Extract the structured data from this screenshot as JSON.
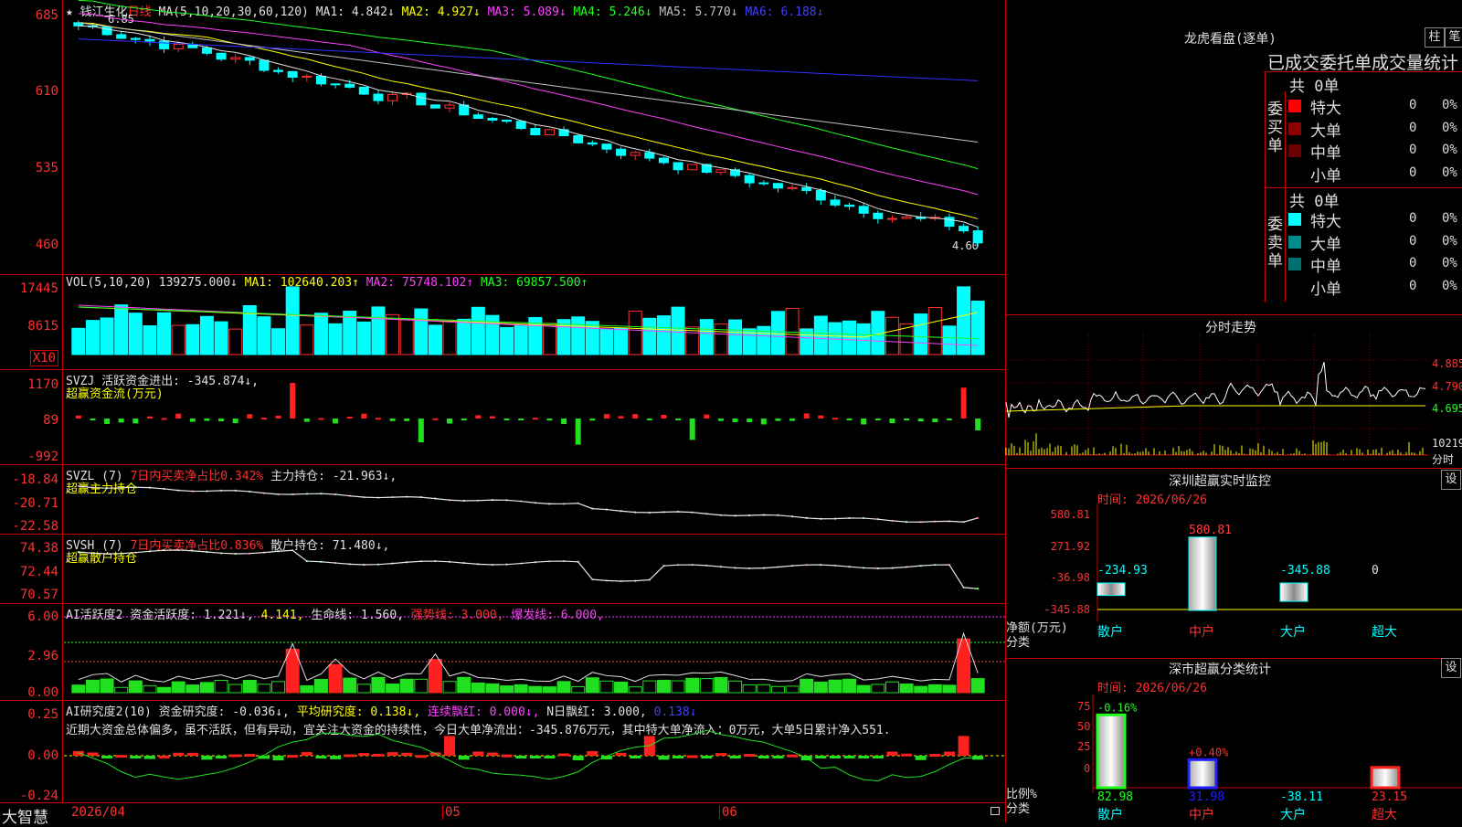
{
  "stock": {
    "name": "钱江生化",
    "period": "日线"
  },
  "ma_header": {
    "prefix": "MA(5,10,20,30,60,120)",
    "ma1": "MA1: 4.842↓",
    "ma2": "MA2: 4.927↓",
    "ma3": "MA3: 5.089↓",
    "ma4": "MA4: 5.246↓",
    "ma5": "MA5: 5.770↓",
    "ma6": "MA6: 6.188↓"
  },
  "price_axis": [
    "685",
    "610",
    "535",
    "460"
  ],
  "price_annot": {
    "high": "6.85",
    "low": "4.60"
  },
  "vol_header": {
    "prefix": "VOL(5,10,20)",
    "value": "139275.000↓",
    "ma1": "MA1: 102640.203↑",
    "ma2": "MA2: 75748.102↑",
    "ma3": "MA3: 69857.500↑"
  },
  "vol_axis": [
    "17445",
    "8615"
  ],
  "vol_unit": "X10",
  "svzj": {
    "line1": "SVZJ  活跃资金进出: -345.874↓,",
    "line2": "超赢资金流(万元)",
    "axis": [
      "1170",
      "89",
      "-992"
    ]
  },
  "svzl": {
    "prefix": "SVZL (7)",
    "pct": "7日内买卖净占比0.342%",
    "hold": "主力持仓: -21.963↓,",
    "line2": "超赢主力持仓",
    "axis": [
      "-18.84",
      "-20.71",
      "-22.58"
    ]
  },
  "svsh": {
    "prefix": "SVSH (7)",
    "pct": "7日内买卖净占比0.836%",
    "hold": "散户持仓: 71.480↓,",
    "line2": "超赢散户持仓",
    "axis": [
      "74.38",
      "72.44",
      "70.57"
    ]
  },
  "ai1": {
    "prefix": "AI活跃度2 资金活跃度: 1.221↓,",
    "v2": "4.141,",
    "life": "生命线: 1.560,",
    "strong": "强势线: 3.000,",
    "burst": "爆发线: 6.000,",
    "axis": [
      "6.00",
      "2.96",
      "0.00"
    ]
  },
  "ai2": {
    "prefix": "AI研究度2(10) 资金研究度: -0.036↓,",
    "avg": "平均研究度: 0.138↓,",
    "red": "连续飘红: 0.000↓,",
    "nday": "N日飘红: 3.000,",
    "last": "0.138↓",
    "axis": [
      "0.25",
      "0.00",
      "-0.24"
    ],
    "comment": "近期大资金总体偏多，虽不活跃，但有异动，宜关注大资金的持续性，今日大单净流出：-345.876万元，其中特大单净流入：0万元，大单5日累计净入551."
  },
  "date_axis": {
    "start": "2026/04",
    "m5": "05",
    "m6": "06"
  },
  "brand": "大智慧",
  "lhb": {
    "title": "龙虎看盘(逐单)",
    "btn1": "柱",
    "btn2": "笔",
    "subtitle": "已成交委托单成交量统计",
    "buy": {
      "label": "委买单",
      "total": "共 0单",
      "rows": [
        {
          "n": "特大",
          "v": "0",
          "p": "0%",
          "c": "#ff0000"
        },
        {
          "n": "大单",
          "v": "0",
          "p": "0%",
          "c": "#8b0000"
        },
        {
          "n": "中单",
          "v": "0",
          "p": "0%",
          "c": "#6b0000"
        },
        {
          "n": "小单",
          "v": "0",
          "p": "0%",
          "c": "#000000"
        }
      ]
    },
    "sell": {
      "label": "委卖单",
      "total": "共 0单",
      "rows": [
        {
          "n": "特大",
          "v": "0",
          "p": "0%",
          "c": "#00ffff"
        },
        {
          "n": "大单",
          "v": "0",
          "p": "0%",
          "c": "#008b8b"
        },
        {
          "n": "中单",
          "v": "0",
          "p": "0%",
          "c": "#007070"
        },
        {
          "n": "小单",
          "v": "0",
          "p": "0%",
          "c": "#000000"
        }
      ]
    }
  },
  "intraday": {
    "title": "分时走势",
    "axis": [
      "4.885",
      "4.790",
      "4.695"
    ],
    "vol": "10219",
    "vol_label": "分时"
  },
  "sz_monitor": {
    "title": "深圳超赢实时监控",
    "btn": "设",
    "time": "时间: 2026/06/26",
    "axis": [
      "580.81",
      "271.92",
      "-36.98",
      "-345.88"
    ],
    "ylabel": "净额(万元)",
    "xlabel": "分类",
    "bars": [
      {
        "n": "散户",
        "v": "-234.93"
      },
      {
        "n": "中户",
        "v": "580.81"
      },
      {
        "n": "大户",
        "v": "-345.88"
      },
      {
        "n": "超大",
        "v": "0"
      }
    ]
  },
  "sz_stats": {
    "title": "深市超赢分类统计",
    "btn": "设",
    "time": "时间: 2026/06/26",
    "axis": [
      "75",
      "50",
      "25",
      "0"
    ],
    "ylabel": "比例%",
    "xlabel": "分类",
    "bars": [
      {
        "n": "散户",
        "v": "82.98",
        "t": "-0.16%"
      },
      {
        "n": "中户",
        "v": "31.98",
        "t": "+0.40%"
      },
      {
        "n": "大户",
        "v": "-38.11",
        "t": ""
      },
      {
        "n": "超大",
        "v": "23.15",
        "t": ""
      }
    ]
  }
}
